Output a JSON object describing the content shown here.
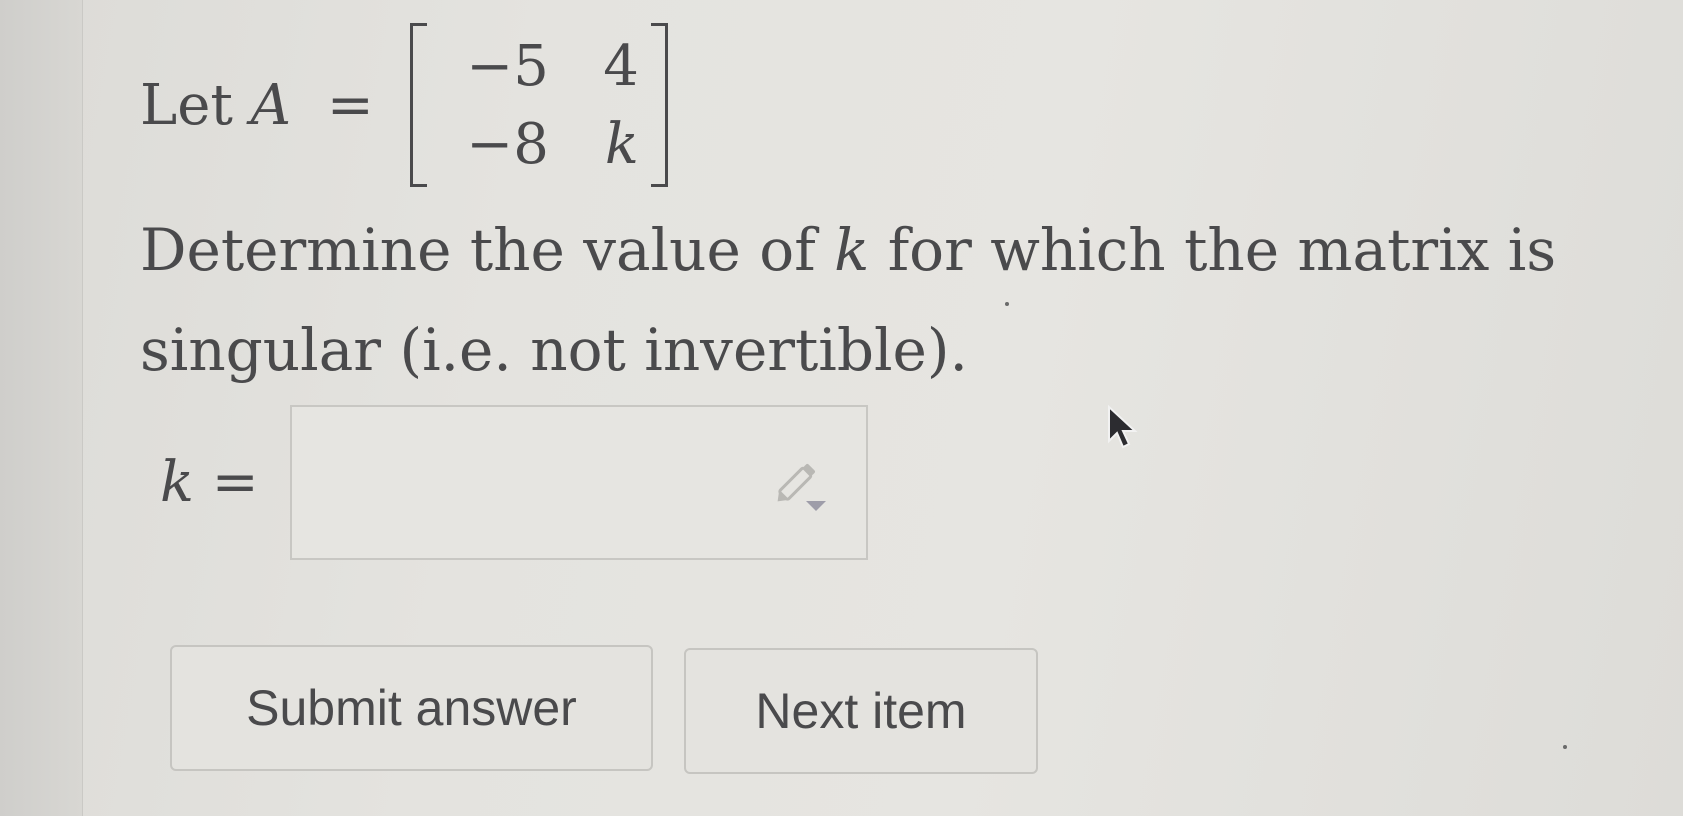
{
  "question": {
    "let_text": "Let",
    "var_name": "A",
    "equals": "=",
    "matrix": [
      [
        "−5",
        "4"
      ],
      [
        "−8",
        "k"
      ]
    ],
    "prompt_before": "Determine the value of ",
    "prompt_var": "k",
    "prompt_after": " for which the matrix is singular (i.e. not invertible)."
  },
  "answer": {
    "label": "k =",
    "value": "",
    "placeholder": "",
    "icon": "pencil-dropdown-icon"
  },
  "buttons": {
    "submit_label": "Submit answer",
    "next_label": "Next item"
  },
  "cursor": {
    "icon": "arrow-cursor-icon"
  }
}
